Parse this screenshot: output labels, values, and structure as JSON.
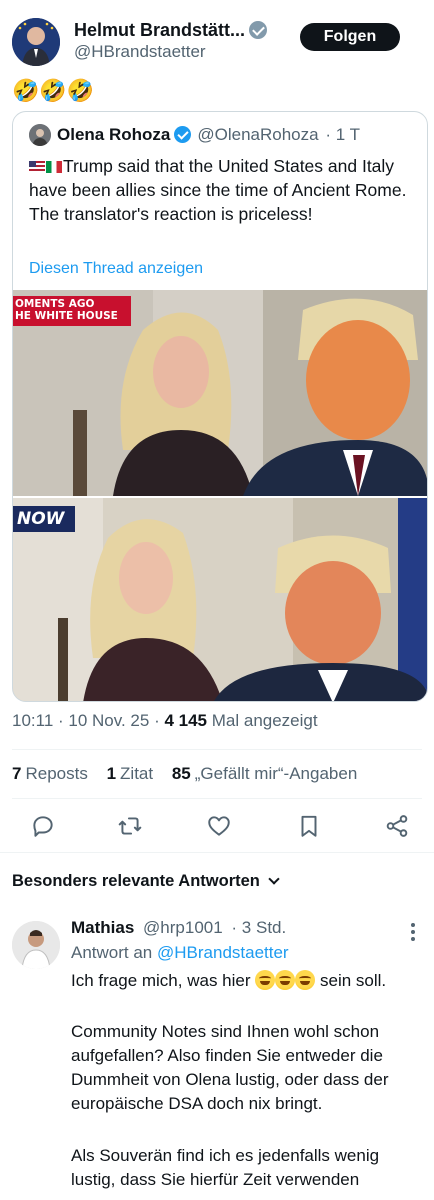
{
  "post": {
    "author_name": "Helmut Brandstätt...",
    "author_handle": "@HBrandstaetter",
    "follow_label": "Folgen",
    "text": "🤣🤣🤣"
  },
  "quote": {
    "author_name": "Olena Rohoza",
    "author_handle": "@OlenaRohoza",
    "time": "· 1 T",
    "text": "Trump said that the United States and Italy have been allies since the time of Ancient Rome. The translator's reaction is priceless!",
    "thread_link": "Diesen Thread anzeigen",
    "media_top_caption_line1": "OMENTS AGO",
    "media_top_caption_line2": "HE WHITE HOUSE",
    "media_bottom_caption": "NOW"
  },
  "meta": {
    "time": "10:11 · 10 Nov. 25 ·",
    "views_count": "4 145",
    "views_label": "Mal angezeigt"
  },
  "stats": {
    "reposts_count": "7",
    "reposts_label": "Reposts",
    "quotes_count": "1",
    "quotes_label": "Zitat",
    "likes_count": "85",
    "likes_label": "„Gefällt mir“-Angaben"
  },
  "actions": [
    "reply-icon",
    "repost-icon",
    "like-icon",
    "bookmark-icon",
    "share-icon"
  ],
  "replies_section": {
    "title": "Besonders relevante Antworten"
  },
  "reply": {
    "author_name": "Mathias",
    "author_handle": "@hrp1001",
    "time": "· 3 Std.",
    "reply_to_label": "Antwort an",
    "reply_to_handle": "@HBrandstaetter",
    "line1_before": "Ich frage mich, was hier",
    "line1_after": "sein soll.",
    "paragraph2": "Community Notes sind Ihnen wohl schon aufgefallen? Also finden Sie entweder die Dummheit von Olena lustig, oder dass der europäische DSA doch nix bringt.",
    "paragraph3": "Als Souverän find ich es jedenfalls wenig lustig, dass Sie hierfür Zeit verwenden"
  },
  "colors": {
    "link": "#1d9bf0",
    "muted": "#536471",
    "text": "#0f1419",
    "border": "#cfd9de"
  }
}
